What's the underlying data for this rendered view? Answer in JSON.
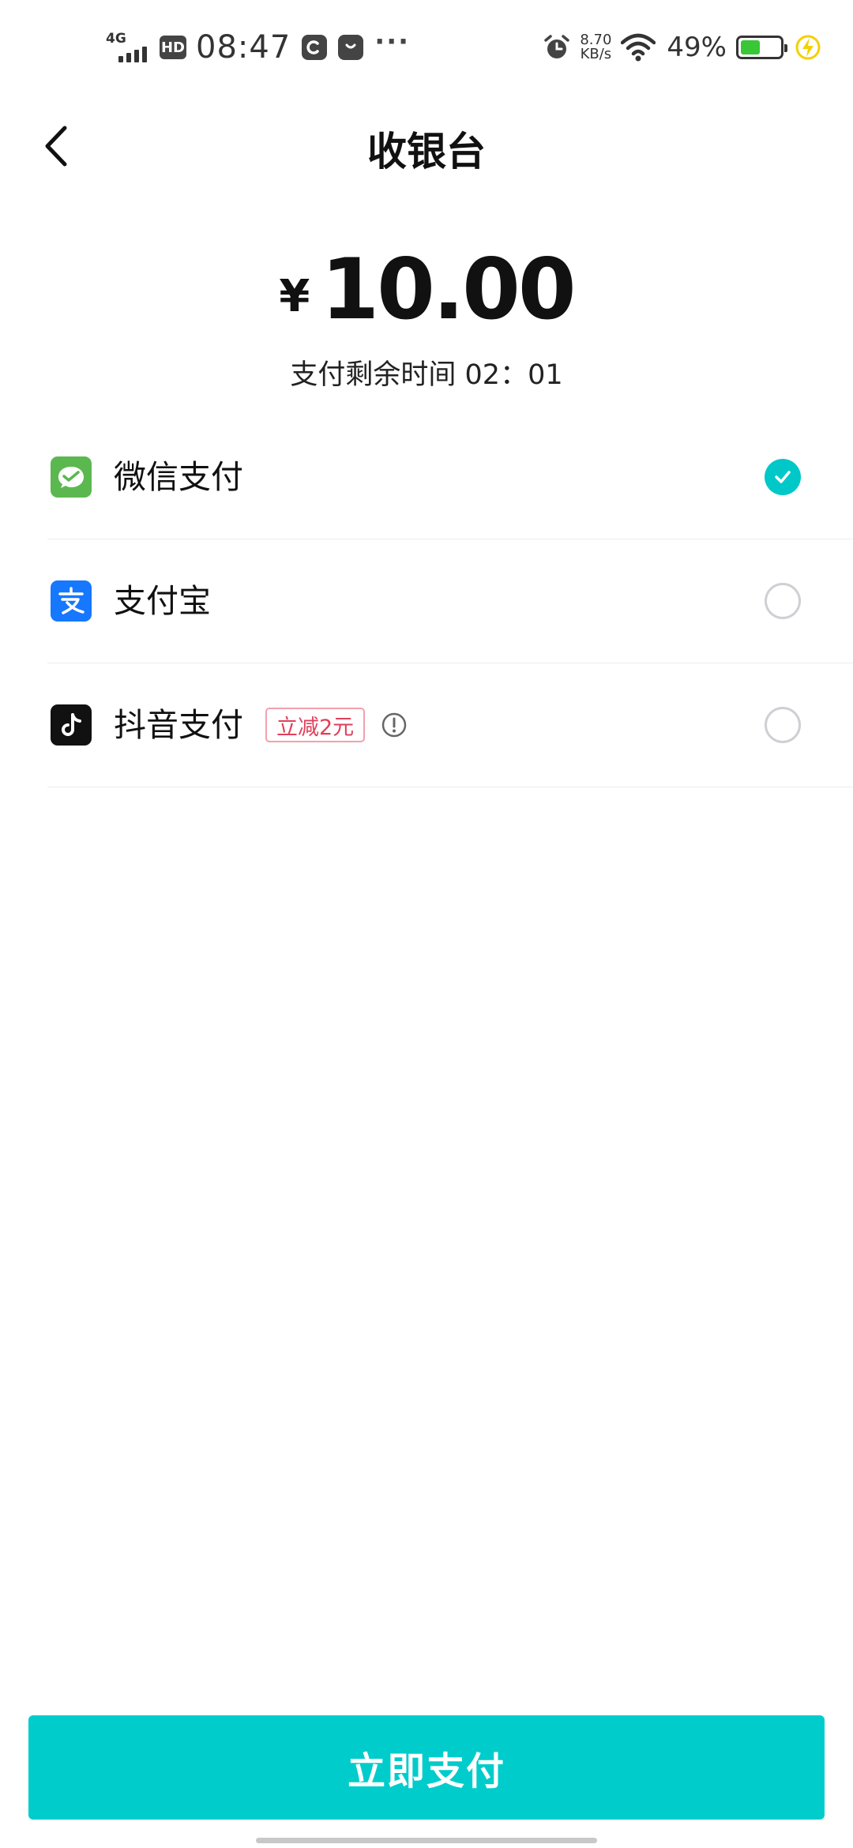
{
  "status_bar": {
    "network": "4G",
    "hd": "HD",
    "time": "08:47",
    "more": "···",
    "speed_value": "8.70",
    "speed_unit": "KB/s",
    "battery_percent": "49%",
    "battery_level": 0.49,
    "battery_color": "#39c637",
    "icons": [
      "signal-icon",
      "hd-icon",
      "app-c-icon",
      "shopping-bag-icon",
      "alarm-icon",
      "wifi-icon",
      "battery-icon",
      "charging-icon"
    ]
  },
  "header": {
    "title": "收银台",
    "back_icon": "chevron-left-icon"
  },
  "payment": {
    "currency": "¥",
    "amount": "10.00",
    "countdown_label": "支付剩余时间",
    "countdown_value": "02：01"
  },
  "methods": [
    {
      "label": "微信支付",
      "icon": "wechat-pay-icon",
      "icon_color": "#5bb84f",
      "selected": true
    },
    {
      "label": "支付宝",
      "icon": "alipay-icon",
      "icon_color": "#1677ff",
      "selected": false
    },
    {
      "label": "抖音支付",
      "icon": "douyin-pay-icon",
      "icon_color": "#111111",
      "selected": false,
      "promo": "立减2元",
      "info_icon": "info-icon"
    }
  ],
  "accent_color": "#00cccc",
  "promo_color": "#e0405a",
  "pay_button": {
    "label": "立即支付"
  }
}
